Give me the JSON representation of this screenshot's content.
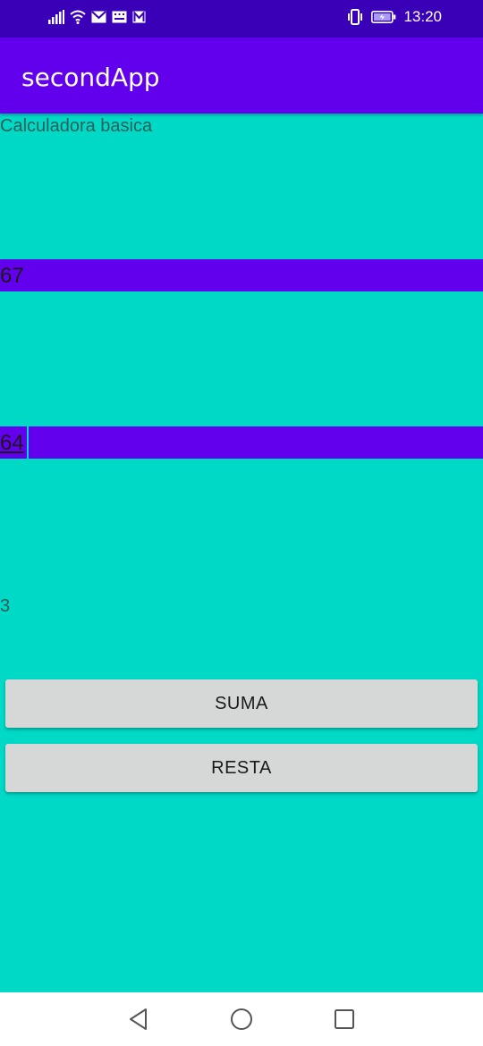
{
  "status_bar": {
    "time": "13:20",
    "icons": [
      "signal-icon",
      "wifi-icon",
      "mail-icon",
      "keyboard-icon",
      "mail-icon",
      "vibrate-icon",
      "battery-charging-icon"
    ]
  },
  "app_bar": {
    "title": "secondApp"
  },
  "main": {
    "heading": "Calculadora basica",
    "number1_value": "67",
    "number2_value": "64",
    "result": "3",
    "sum_button": "SUMA",
    "subtract_button": "RESTA"
  },
  "nav_bar": {
    "icons": [
      "back-icon",
      "home-icon",
      "recents-icon"
    ]
  },
  "colors": {
    "background": "#00d9c6",
    "app_bar": "#6200ee",
    "status_bar": "#3a00b8",
    "input_bg": "#6200ee",
    "button": "#d6d7d7"
  }
}
